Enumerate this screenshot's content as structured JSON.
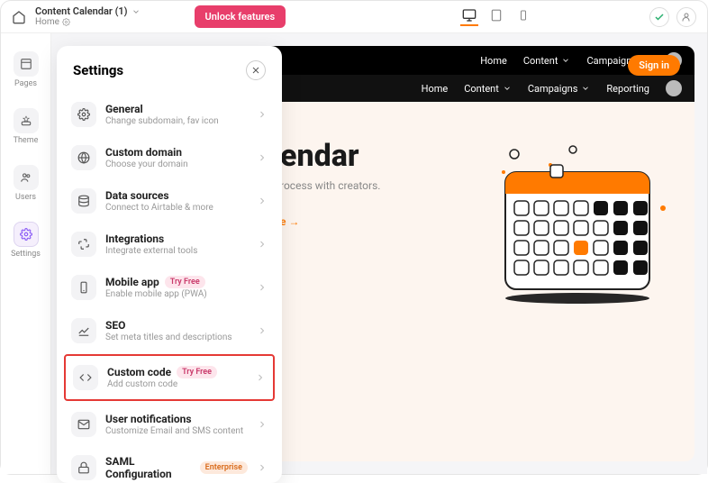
{
  "topbar": {
    "project_name": "Content Calendar (1)",
    "breadcrumb_sub": "Home",
    "unlock_label": "Unlock features"
  },
  "leftrail": {
    "items": [
      {
        "label": "Pages"
      },
      {
        "label": "Theme"
      },
      {
        "label": "Users"
      },
      {
        "label": "Settings"
      }
    ]
  },
  "preview": {
    "signin_label": "Sign in",
    "nav1": {
      "home": "Home",
      "content": "Content",
      "campaigns": "Campaigns"
    },
    "nav2": {
      "home": "Home",
      "content": "Content",
      "campaigns": "Campaigns",
      "reporting": "Reporting"
    },
    "hero_title_fragment": "endar",
    "hero_sub_fragment": "rocess with creators.",
    "cta_fragment": "e  →"
  },
  "settings_panel": {
    "title": "Settings",
    "items": [
      {
        "title": "General",
        "sub": "Change subdomain, fav icon",
        "badge": null
      },
      {
        "title": "Custom domain",
        "sub": "Choose your domain",
        "badge": null
      },
      {
        "title": "Data sources",
        "sub": "Connect to Airtable & more",
        "badge": null
      },
      {
        "title": "Integrations",
        "sub": "Integrate external tools",
        "badge": null
      },
      {
        "title": "Mobile app",
        "sub": "Enable mobile app (PWA)",
        "badge": "Try Free",
        "badge_color": "pink"
      },
      {
        "title": "SEO",
        "sub": "Set meta titles and descriptions",
        "badge": null
      },
      {
        "title": "Custom code",
        "sub": "Add custom code",
        "badge": "Try Free",
        "badge_color": "pink",
        "highlighted": true
      },
      {
        "title": "User notifications",
        "sub": "Customize Email and SMS content",
        "badge": null
      },
      {
        "title": "SAML Configuration",
        "sub": "",
        "badge": "Enterprise",
        "badge_color": "orange"
      }
    ]
  }
}
